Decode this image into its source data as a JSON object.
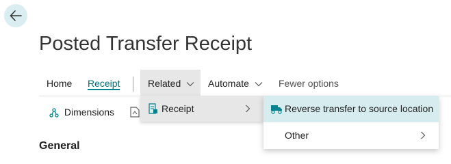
{
  "page": {
    "title": "Posted Transfer Receipt"
  },
  "nav": {
    "back_icon": "arrow-left-icon"
  },
  "tabs": [
    {
      "label": "Home"
    },
    {
      "label": "Receipt",
      "active": true
    },
    {
      "label": "Related",
      "open": true
    },
    {
      "label": "Automate"
    },
    {
      "label": "Fewer options"
    }
  ],
  "actions": {
    "dimensions": "Dimensions"
  },
  "related_menu": {
    "items": [
      {
        "label": "Receipt",
        "icon": "receipt-icon",
        "has_submenu": true
      }
    ]
  },
  "receipt_submenu": {
    "items": [
      {
        "label": "Reverse transfer to source location",
        "icon": "truck-icon",
        "highlighted": true
      },
      {
        "label": "Other",
        "has_submenu": true
      }
    ]
  },
  "sections": {
    "general": "General"
  },
  "colors": {
    "accent": "#00838f",
    "highlight": "#d6ecef",
    "menu_bg": "#e7e7e7"
  }
}
